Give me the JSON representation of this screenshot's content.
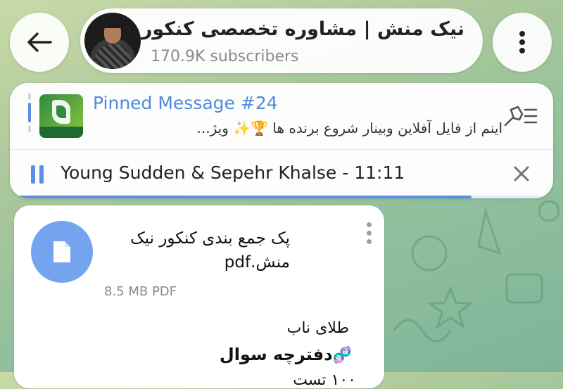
{
  "header": {
    "channel_title": "نیک منش | مشاوره تخصصی کنکور",
    "subscribers": "170.9K subscribers"
  },
  "pinned": {
    "title": "Pinned Message #24",
    "preview": "اینم از فایل آفلاین وبینار شروع برنده ها 🏆✨ ویژ..."
  },
  "player": {
    "track": "Young Sudden & Sepehr Khalse - 11:11",
    "progress": 0.85
  },
  "message": {
    "file_name": "پک جمع بندی کنکور نیک منش.pdf",
    "file_meta": "8.5 MB PDF",
    "line1": "طلای ناب",
    "line2": "دفترچه سوال",
    "line2_emoji": "🧬",
    "line3": "۱۰۰ تست"
  },
  "colors": {
    "accent": "#5b8fe6",
    "file_icon_bg": "#75a4ee"
  }
}
